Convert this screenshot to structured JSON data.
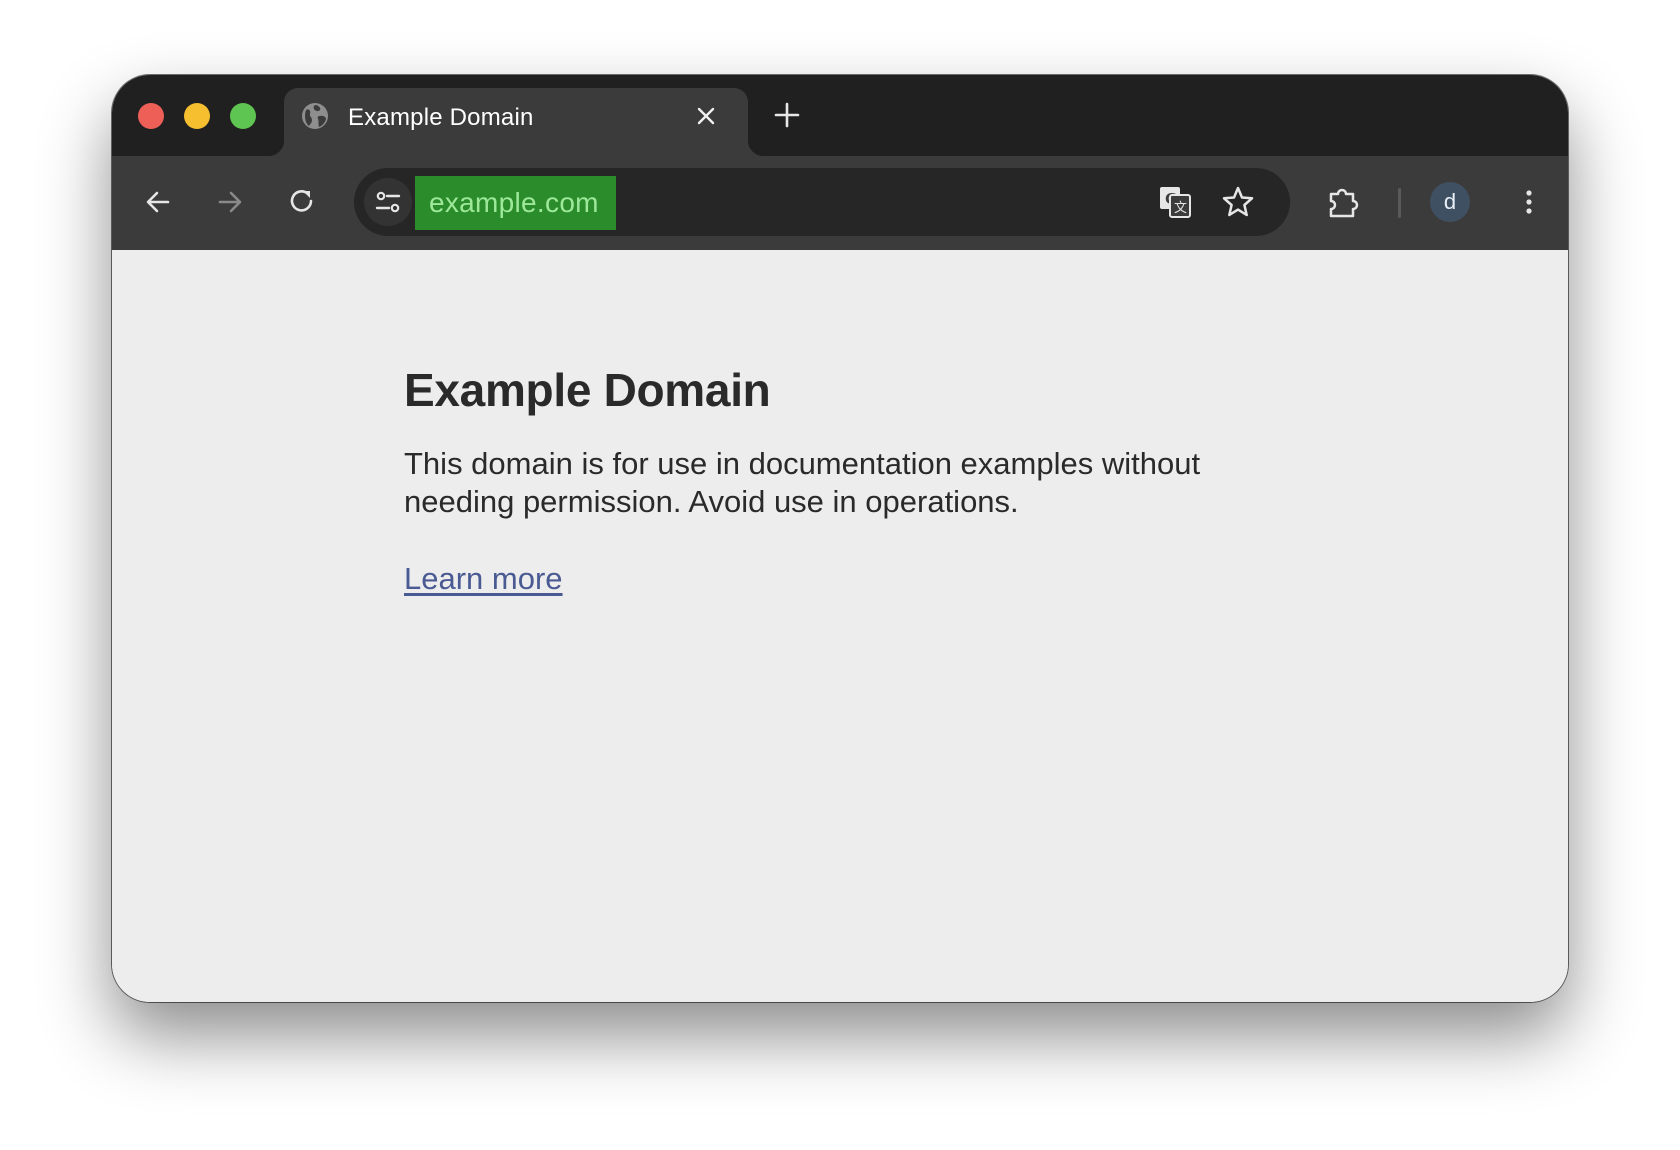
{
  "window": {
    "controls": [
      "close",
      "minimize",
      "maximize"
    ]
  },
  "tab": {
    "title": "Example Domain",
    "favicon": "globe-icon",
    "close_icon": "close-icon"
  },
  "toolbar": {
    "new_tab_icon": "plus-icon",
    "back_icon": "arrow-left-icon",
    "forward_icon": "arrow-right-icon",
    "reload_icon": "reload-icon",
    "site_info_icon": "tune-icon",
    "url": "example.com",
    "translate_icon": "translate-icon",
    "bookmark_icon": "star-icon",
    "extensions_icon": "puzzle-icon",
    "profile_initial": "d",
    "menu_icon": "kebab-menu-icon"
  },
  "page": {
    "title": "Example Domain",
    "description": "This domain is for use in documentation examples without needing permission. Avoid use in operations.",
    "link_text": "Learn more"
  },
  "colors": {
    "titlebar": "#202020",
    "toolbar": "#3b3b3b",
    "omnibox": "#262626",
    "url_highlight": "#2b8c2b",
    "url_text": "#9ee89a",
    "page_background": "#ededed",
    "link": "#4a5a93"
  }
}
